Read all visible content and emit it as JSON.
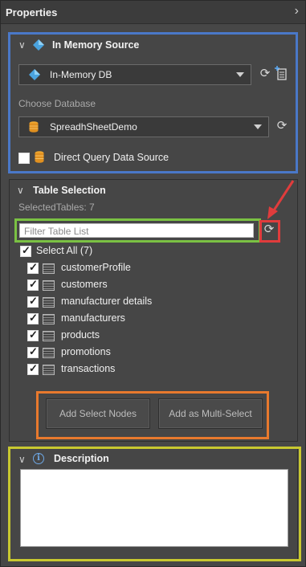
{
  "panel": {
    "title": "Properties"
  },
  "source": {
    "header": "In Memory Source",
    "db_selected": "In-Memory DB",
    "choose_db_label": "Choose Database",
    "db_name": "SpreadhSheetDemo",
    "direct_query_label": "Direct Query Data Source",
    "direct_query_checked": false
  },
  "tables": {
    "header": "Table Selection",
    "selected_count": "SelectedTables: 7",
    "filter_placeholder": "Filter Table List",
    "select_all": "Select All (7)",
    "items": [
      {
        "label": "customerProfile",
        "checked": true
      },
      {
        "label": "customers",
        "checked": true
      },
      {
        "label": "manufacturer details",
        "checked": true
      },
      {
        "label": "manufacturers",
        "checked": true
      },
      {
        "label": "products",
        "checked": true
      },
      {
        "label": "promotions",
        "checked": true
      },
      {
        "label": "transactions",
        "checked": true
      }
    ],
    "btn_add_nodes": "Add Select Nodes",
    "btn_multi_select": "Add as Multi-Select"
  },
  "description": {
    "header": "Description",
    "value": ""
  },
  "colors": {
    "highlight_blue": "#4a78c8",
    "highlight_green": "#7ac143",
    "highlight_red": "#e03c3c",
    "highlight_orange": "#e8792d",
    "highlight_yellow": "#c8c830"
  }
}
